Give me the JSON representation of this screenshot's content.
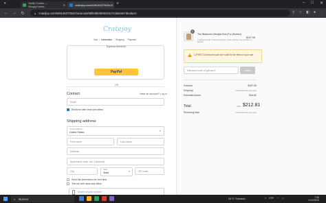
{
  "browser": {
    "tabs": [
      {
        "title": "Verify Codes — SimplyCodes",
        "favicon_color": "#2e9e5b"
      },
      {
        "title": "crateljoy.com/60814637353/c",
        "favicon_color": "#1a73e8"
      }
    ],
    "new_tab": "+",
    "url": "crateljoy.com/60814637353/checkouts/86f548b0606225c7cda64e67dea9a2c",
    "window_controls": [
      "–",
      "□",
      "✕"
    ]
  },
  "checkout": {
    "logo": "Cratejoy",
    "breadcrumbs": [
      "Cart",
      "Information",
      "Shipping",
      "Payment"
    ],
    "express_label": "Express checkout",
    "paypal_label": "PayPal",
    "or_text": "OR",
    "contact_heading": "Contact",
    "account_prompt": "Have an account?",
    "login_link": "Log in",
    "email_placeholder": "Email",
    "email_news_label": "Email me with news and offers",
    "shipping_heading": "Shipping address",
    "country_label": "Country/Region",
    "country_value": "United States",
    "first_name": "First name",
    "last_name": "Last name",
    "address": "Address",
    "apartment": "Apartment, suite, etc. (optional)",
    "city": "City",
    "state_label": "State",
    "state_value": "State",
    "zip": "ZIP code",
    "save_info_label": "Save this information for next time",
    "text_news_label": "Text me with news and offers",
    "mobile_placeholder": "Mobile phone number",
    "fine_print": "By signing up via text, you agree to receive recurring automated marketing messages, including cart reminders, at the phone number provided. Consent is not a condition of purchase. Reply STOP to unsubscribe. Reply HELP for help. Message frequency varies. Msg & data rates may apply. View our Privacy policy and Terms of Service."
  },
  "summary": {
    "quantity": "1",
    "product_title": "The Balanced Lifestyle Box (For Women)",
    "product_subtitle": "6 deliveries total / 6 Months Pre-Pay / Fats, Sensory, Frig, Sunday / 3 Months",
    "product_price": "$197.99",
    "notice": "CJFIRST10 discount code isn't valid for the items in your cart",
    "discount_placeholder": "Discount code or gift card",
    "apply_label": "Apply",
    "subtotal_label": "Subtotal",
    "subtotal_value": "$197.99",
    "shipping_label": "Shipping",
    "shipping_value": "Calculated at next step",
    "taxes_label": "Estimated taxes",
    "taxes_value": "$14.82",
    "total_label": "Total",
    "currency": "USD",
    "total_value": "$212.81",
    "recurring_label": "Recurring total",
    "recurring_value": "Calculated at next step"
  },
  "taskbar": {
    "search_label": "Buscar",
    "weather": "24°C  Soleado",
    "tray_lang": "ESP",
    "time": "7:55",
    "date": "2/12/2023",
    "app_colors": [
      "#3a7bd5",
      "#f2b31c",
      "#2e9e5b",
      "#d33c2e",
      "#8a5cd1"
    ]
  }
}
